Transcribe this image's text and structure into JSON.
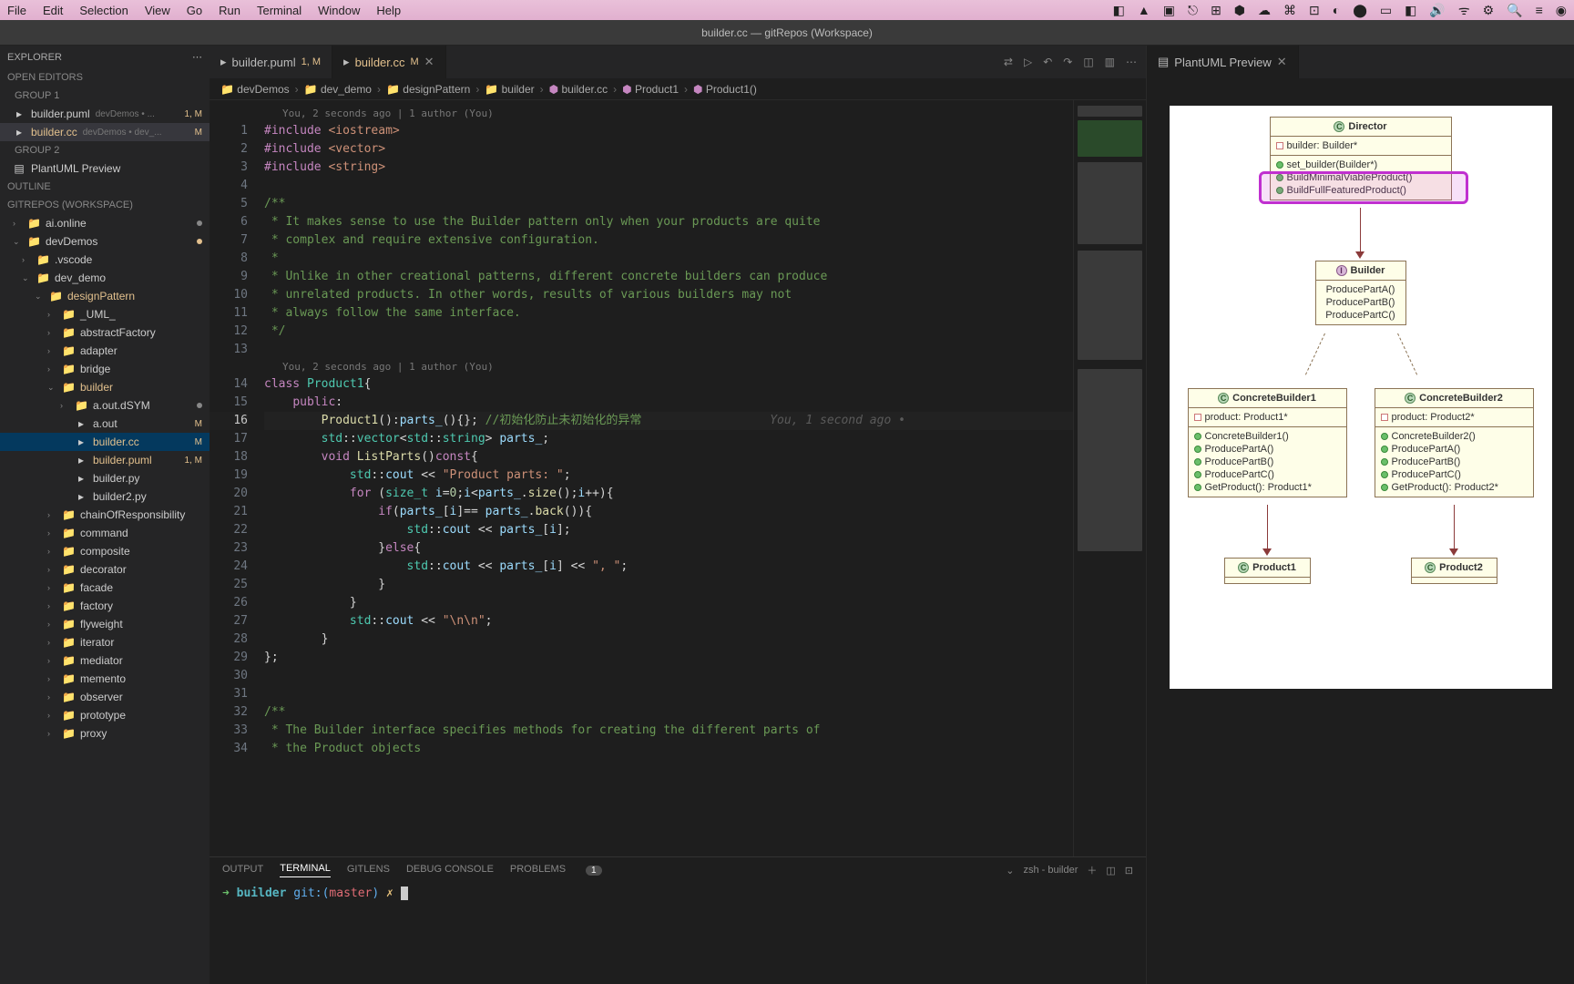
{
  "mac_menu": {
    "items": [
      "File",
      "Edit",
      "Selection",
      "View",
      "Go",
      "Run",
      "Terminal",
      "Window",
      "Help"
    ],
    "tray": [
      "◧",
      "▲",
      "▣",
      "⎋",
      "⊞",
      "⬢",
      "☁",
      "⌘",
      "⊡",
      "◐",
      "⬤",
      "▭",
      "◧",
      "🔊",
      "ᯤ",
      "⚙",
      "🔍",
      "≡",
      "◉"
    ]
  },
  "title": "builder.cc — gitRepos (Workspace)",
  "explorer": {
    "header": "EXPLORER",
    "sections": {
      "open_editors": "OPEN EDITORS",
      "group1": "GROUP 1",
      "group2": "GROUP 2",
      "outline": "OUTLINE",
      "workspace": "GITREPOS (WORKSPACE)"
    },
    "open": [
      {
        "name": "builder.puml",
        "meta": "devDemos • ...",
        "badge": "1, M"
      },
      {
        "name": "builder.cc",
        "meta": "devDemos • dev_...",
        "badge": "M",
        "active": true
      }
    ],
    "group2": [
      {
        "name": "PlantUML Preview"
      }
    ],
    "tree": [
      {
        "name": "ai.online",
        "icon": "📁",
        "chev": "›",
        "dot": true
      },
      {
        "name": "devDemos",
        "icon": "📁",
        "chev": "⌄",
        "dot": "mod"
      },
      {
        "name": ".vscode",
        "icon": "📁",
        "chev": "›",
        "indent": 1
      },
      {
        "name": "dev_demo",
        "icon": "📁",
        "chev": "⌄",
        "indent": 1
      },
      {
        "name": "designPattern",
        "icon": "📁",
        "chev": "⌄",
        "indent": 2,
        "color": "#e2c08d"
      },
      {
        "name": "_UML_",
        "icon": "📁",
        "chev": "›",
        "indent": 3
      },
      {
        "name": "abstractFactory",
        "icon": "📁",
        "chev": "›",
        "indent": 3
      },
      {
        "name": "adapter",
        "icon": "📁",
        "chev": "›",
        "indent": 3
      },
      {
        "name": "bridge",
        "icon": "📁",
        "chev": "›",
        "indent": 3
      },
      {
        "name": "builder",
        "icon": "📁",
        "chev": "⌄",
        "indent": 3,
        "color": "#e2c08d"
      },
      {
        "name": "a.out.dSYM",
        "icon": "📁",
        "chev": "›",
        "indent": 4,
        "dot": true
      },
      {
        "name": "a.out",
        "icon": "▸",
        "indent": 4,
        "badge": "M"
      },
      {
        "name": "builder.cc",
        "icon": "▸",
        "indent": 4,
        "badge": "M",
        "selected": true,
        "color": "#e2c08d"
      },
      {
        "name": "builder.puml",
        "icon": "▸",
        "indent": 4,
        "badge": "1, M",
        "color": "#e2c08d"
      },
      {
        "name": "builder.py",
        "icon": "▸",
        "indent": 4
      },
      {
        "name": "builder2.py",
        "icon": "▸",
        "indent": 4
      },
      {
        "name": "chainOfResponsibility",
        "icon": "📁",
        "chev": "›",
        "indent": 3
      },
      {
        "name": "command",
        "icon": "📁",
        "chev": "›",
        "indent": 3
      },
      {
        "name": "composite",
        "icon": "📁",
        "chev": "›",
        "indent": 3
      },
      {
        "name": "decorator",
        "icon": "📁",
        "chev": "›",
        "indent": 3
      },
      {
        "name": "facade",
        "icon": "📁",
        "chev": "›",
        "indent": 3
      },
      {
        "name": "factory",
        "icon": "📁",
        "chev": "›",
        "indent": 3
      },
      {
        "name": "flyweight",
        "icon": "📁",
        "chev": "›",
        "indent": 3
      },
      {
        "name": "iterator",
        "icon": "📁",
        "chev": "›",
        "indent": 3
      },
      {
        "name": "mediator",
        "icon": "📁",
        "chev": "›",
        "indent": 3
      },
      {
        "name": "memento",
        "icon": "📁",
        "chev": "›",
        "indent": 3
      },
      {
        "name": "observer",
        "icon": "📁",
        "chev": "›",
        "indent": 3
      },
      {
        "name": "prototype",
        "icon": "📁",
        "chev": "›",
        "indent": 3
      },
      {
        "name": "proxy",
        "icon": "📁",
        "chev": "›",
        "indent": 3
      }
    ]
  },
  "tabs": [
    {
      "name": "builder.puml",
      "badge": "1, M",
      "icon": "▸"
    },
    {
      "name": "builder.cc",
      "badge": "M",
      "icon": "▸",
      "active": true,
      "dot": true
    }
  ],
  "breadcrumb": [
    "devDemos",
    "dev_demo",
    "designPattern",
    "builder",
    "builder.cc",
    "Product1",
    "Product1()"
  ],
  "codelens1": "You, 2 seconds ago | 1 author (You)",
  "codelens2": "You, 2 seconds ago | 1 author (You)",
  "inline_blame": "You, 1 second ago •",
  "code_lines": [
    {
      "n": 1,
      "html": "<span class='pp'>#include</span> <span class='inc'>&lt;iostream&gt;</span>"
    },
    {
      "n": 2,
      "html": "<span class='pp'>#include</span> <span class='inc'>&lt;vector&gt;</span>"
    },
    {
      "n": 3,
      "html": "<span class='pp'>#include</span> <span class='inc'>&lt;string&gt;</span>"
    },
    {
      "n": 4,
      "html": ""
    },
    {
      "n": 5,
      "html": "<span class='cm'>/**</span>"
    },
    {
      "n": 6,
      "html": "<span class='cm'> * It makes sense to use the Builder pattern only when your products are quite</span>"
    },
    {
      "n": 7,
      "html": "<span class='cm'> * complex and require extensive configuration.</span>"
    },
    {
      "n": 8,
      "html": "<span class='cm'> *</span>"
    },
    {
      "n": 9,
      "html": "<span class='cm'> * Unlike in other creational patterns, different concrete builders can produce</span>"
    },
    {
      "n": 10,
      "html": "<span class='cm'> * unrelated products. In other words, results of various builders may not</span>"
    },
    {
      "n": 11,
      "html": "<span class='cm'> * always follow the same interface.</span>"
    },
    {
      "n": 12,
      "html": "<span class='cm'> */</span>"
    },
    {
      "n": 13,
      "html": ""
    },
    {
      "n": 14,
      "html": "<span class='kw'>class</span> <span class='ty'>Product1</span>{",
      "lens": true
    },
    {
      "n": 15,
      "html": "    <span class='kw'>public</span>:"
    },
    {
      "n": 16,
      "html": "        <span class='fn'>Product1</span>():<span class='vr'>parts_</span>(){}; <span class='cm'>//初始化防止未初始化的异常</span>",
      "hl": true,
      "blame": true
    },
    {
      "n": 17,
      "html": "        <span class='ty'>std</span>::<span class='ty'>vector</span>&lt;<span class='ty'>std</span>::<span class='ty'>string</span>&gt; <span class='vr'>parts_</span>;"
    },
    {
      "n": 18,
      "html": "        <span class='kw'>void</span> <span class='fn'>ListParts</span>()<span class='kw'>const</span>{"
    },
    {
      "n": 19,
      "html": "            <span class='ty'>std</span>::<span class='vr'>cout</span> &lt;&lt; <span class='st'>\"Product parts: \"</span>;"
    },
    {
      "n": 20,
      "html": "            <span class='kw'>for</span> (<span class='ty'>size_t</span> <span class='vr'>i</span>=<span class='nm'>0</span>;<span class='vr'>i</span>&lt;<span class='vr'>parts_</span>.<span class='fn'>size</span>();<span class='vr'>i</span>++){"
    },
    {
      "n": 21,
      "html": "                <span class='kw'>if</span>(<span class='vr'>parts_</span>[<span class='vr'>i</span>]== <span class='vr'>parts_</span>.<span class='fn'>back</span>()){"
    },
    {
      "n": 22,
      "html": "                    <span class='ty'>std</span>::<span class='vr'>cout</span> &lt;&lt; <span class='vr'>parts_</span>[<span class='vr'>i</span>];"
    },
    {
      "n": 23,
      "html": "                }<span class='kw'>else</span>{"
    },
    {
      "n": 24,
      "html": "                    <span class='ty'>std</span>::<span class='vr'>cout</span> &lt;&lt; <span class='vr'>parts_</span>[<span class='vr'>i</span>] &lt;&lt; <span class='st'>\", \"</span>;"
    },
    {
      "n": 25,
      "html": "                }"
    },
    {
      "n": 26,
      "html": "            }"
    },
    {
      "n": 27,
      "html": "            <span class='ty'>std</span>::<span class='vr'>cout</span> &lt;&lt; <span class='st'>\"\\n\\n\"</span>;"
    },
    {
      "n": 28,
      "html": "        }"
    },
    {
      "n": 29,
      "html": "};"
    },
    {
      "n": 30,
      "html": ""
    },
    {
      "n": 31,
      "html": ""
    },
    {
      "n": 32,
      "html": "<span class='cm'>/**</span>"
    },
    {
      "n": 33,
      "html": "<span class='cm'> * The Builder interface specifies methods for creating the different parts of</span>"
    },
    {
      "n": 34,
      "html": "<span class='cm'> * the Product objects</span>"
    }
  ],
  "preview_tab": "PlantUML Preview",
  "uml": {
    "director": {
      "title": "Director",
      "attrs": [
        "builder: Builder*"
      ],
      "ops": [
        "set_builder(Builder*)",
        "BuildMinimalViableProduct()",
        "BuildFullFeaturedProduct()"
      ]
    },
    "builder": {
      "title": "Builder",
      "ops": [
        "ProducePartA()",
        "ProducePartB()",
        "ProducePartC()"
      ]
    },
    "cb1": {
      "title": "ConcreteBuilder1",
      "attrs": [
        "product: Product1*"
      ],
      "ops": [
        "ConcreteBuilder1()",
        "ProducePartA()",
        "ProducePartB()",
        "ProducePartC()",
        "GetProduct(): Product1*"
      ]
    },
    "cb2": {
      "title": "ConcreteBuilder2",
      "attrs": [
        "product: Product2*"
      ],
      "ops": [
        "ConcreteBuilder2()",
        "ProducePartA()",
        "ProducePartB()",
        "ProducePartC()",
        "GetProduct(): Product2*"
      ]
    },
    "p1": "Product1",
    "p2": "Product2"
  },
  "terminal": {
    "tabs": [
      "OUTPUT",
      "TERMINAL",
      "GITLENS",
      "DEBUG CONSOLE",
      "PROBLEMS"
    ],
    "problems_count": "1",
    "shell_label": "zsh - builder",
    "prompt": {
      "arrow": "➜ ",
      "path": "builder",
      "git": "git:(",
      "branch": "master",
      "git2": ")",
      "x": " ✗ "
    }
  }
}
